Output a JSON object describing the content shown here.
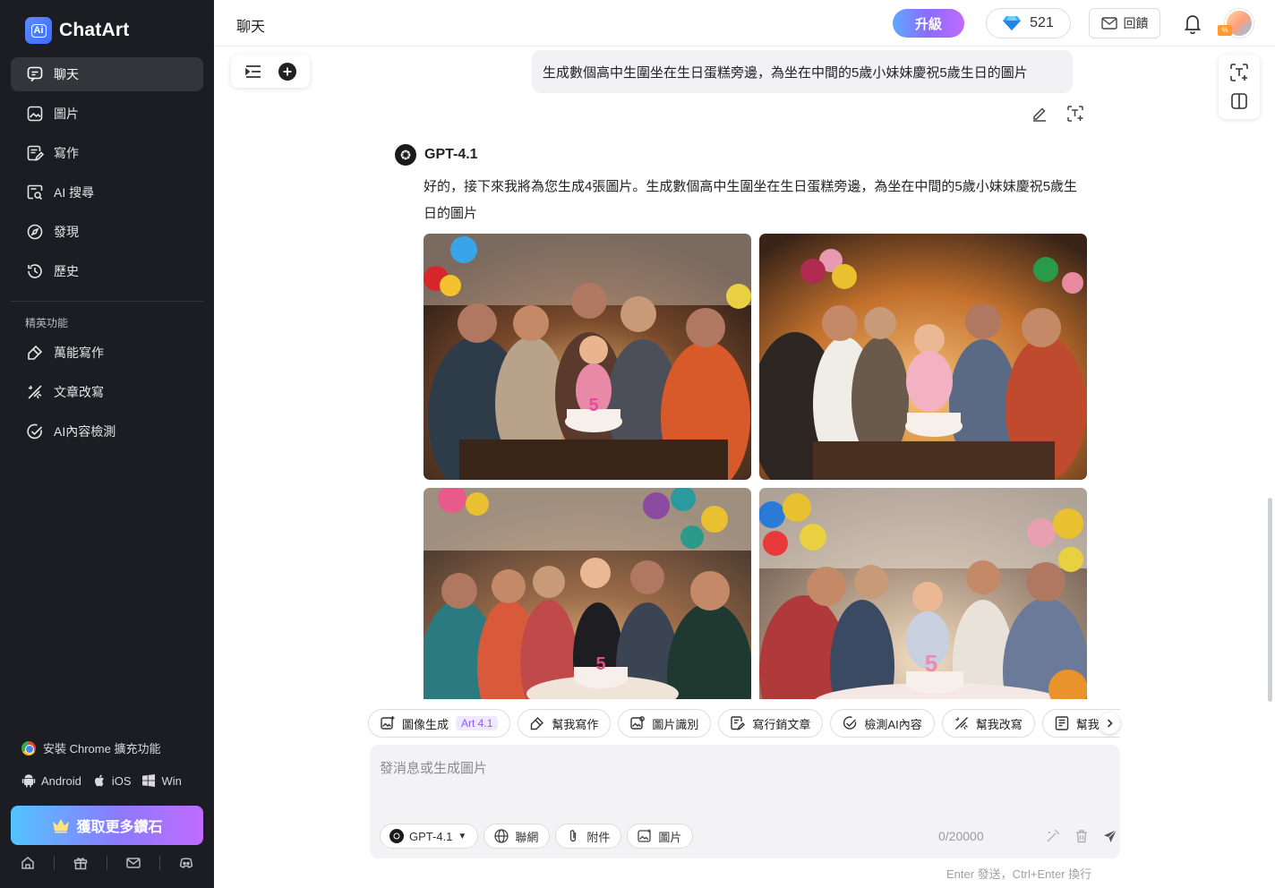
{
  "app": {
    "name": "ChatArt"
  },
  "sidebar": {
    "items": [
      {
        "label": "聊天",
        "icon": "chat-icon"
      },
      {
        "label": "圖片",
        "icon": "image-icon"
      },
      {
        "label": "寫作",
        "icon": "write-icon"
      },
      {
        "label": "AI 搜尋",
        "icon": "ai-search-icon"
      },
      {
        "label": "發現",
        "icon": "compass-icon"
      },
      {
        "label": "歷史",
        "icon": "history-icon"
      }
    ],
    "section_title": "精英功能",
    "pro_items": [
      {
        "label": "萬能寫作",
        "icon": "magic-write-icon"
      },
      {
        "label": "文章改寫",
        "icon": "rewrite-icon"
      },
      {
        "label": "AI內容檢測",
        "icon": "ai-detect-icon"
      }
    ],
    "chrome_ext": "安裝 Chrome 擴充功能",
    "platforms": [
      "Android",
      "iOS",
      "Win"
    ],
    "cta": "獲取更多鑽石"
  },
  "topbar": {
    "title": "聊天",
    "upgrade": "升級",
    "gems": "521",
    "feedback": "回饋"
  },
  "chat": {
    "user_message": "生成數個高中生圍坐在生日蛋糕旁邊，為坐在中間的5歲小妹妹慶祝5歲生日的圖片",
    "bot_name": "GPT-4.1",
    "bot_message": "好的，接下來我將為您生成4張圖片。生成數個高中生圍坐在生日蛋糕旁邊，為坐在中間的5歲小妹妹慶祝5歲生日的圖片"
  },
  "tools": [
    {
      "label": "圖像生成",
      "tag": "Art 4.1",
      "icon": "image-gen-icon"
    },
    {
      "label": "幫我寫作",
      "tag": "",
      "icon": "magic-write-icon"
    },
    {
      "label": "圖片識別",
      "tag": "",
      "icon": "image-recognize-icon"
    },
    {
      "label": "寫行銷文章",
      "tag": "",
      "icon": "marketing-icon"
    },
    {
      "label": "檢測AI內容",
      "tag": "",
      "icon": "ai-detect-icon"
    },
    {
      "label": "幫我改寫",
      "tag": "",
      "icon": "rewrite-icon"
    },
    {
      "label": "幫我寫小說",
      "tag": "",
      "icon": "novel-icon"
    }
  ],
  "composer": {
    "placeholder": "發消息或生成圖片",
    "model": "GPT-4.1",
    "web": "聯網",
    "attach": "附件",
    "image": "圖片",
    "counter": "0/20000",
    "hint": "Enter 發送，Ctrl+Enter 換行"
  },
  "colors": {
    "sidebar_bg": "#1c1d22",
    "accent": "#8b7bff",
    "bubble_bg": "#f2f2f5"
  }
}
